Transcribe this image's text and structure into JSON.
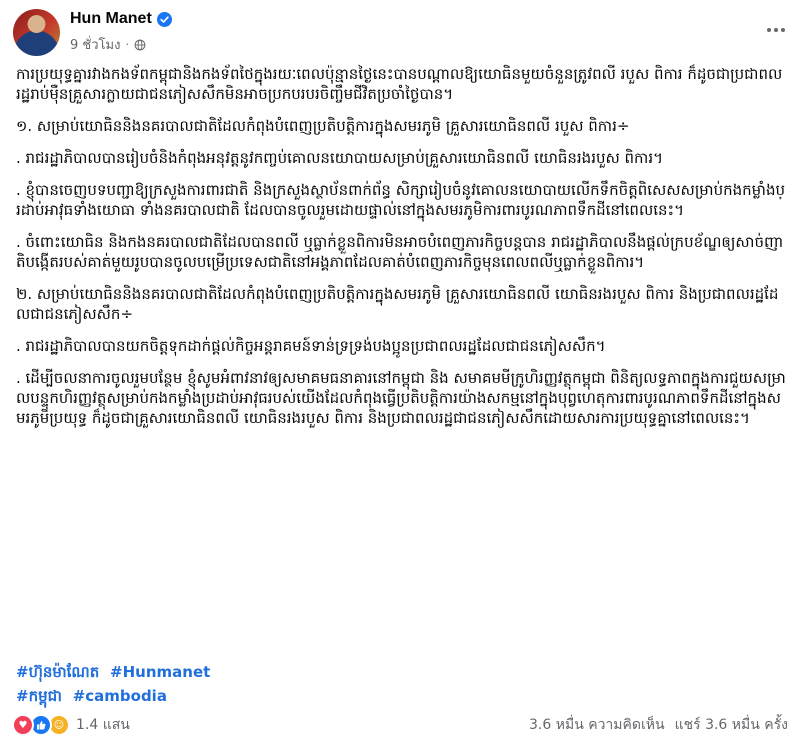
{
  "post": {
    "author": "Hun Manet",
    "time": "9 ชั่วโมง",
    "privacy_icon": "globe-icon",
    "verified_icon": "verified-badge-icon",
    "more_icon": "more-options-icon"
  },
  "content": {
    "paragraphs": [
      "ការប្រយុទ្ធគ្នារវាងកងទ័ពកម្ពុជានិងកងទ័ពថៃក្នុងរយៈពេលប៉ុន្មានថ្ងៃនេះបានបណ្តាលឱ្យយោធិនមួយចំនួនត្រូវពលី របួស ពិការ ក៏ដូចជាប្រជាពលរដ្ឋរាប់ម៉ឺនគ្រួសារក្លាយជាជនភៀសសឹកមិនអាចប្រកបរបរចិញ្ចឹមជីវិតប្រចាំថ្ងៃបាន។",
      "១. សម្រាប់យោធិននិងនគរបាលជាតិដែលកំពុងបំពេញប្រតិបត្តិការក្នុងសមរភូមិ គ្រួសារយោធិនពលី របួស ពិការ÷",
      ". រាជរដ្ឋាភិបាលបានរៀបចំនិងកំពុងអនុវត្តនូវកញ្ចប់គោលនយោបាយសម្រាប់គ្រួសារយោធិនពលី យោធិនរងរបួស ពិការ។",
      ". ខ្ញុំបានចេញបទបញ្ជាឱ្យក្រសួងការពារជាតិ និងក្រសួងស្ថាប័នពាក់ព័ន្ធ សិក្សារៀបចំនូវគោលនយោបាយលើកទឹកចិត្តពិសេសសម្រាប់កងកម្លាំងប្រដាប់អាវុធទាំងយោធា ទាំងនគរបាលជាតិ ដែលបានចូលរួមដោយផ្ទាល់នៅក្នុងសមរភូមិការពារបូរណភាពទឹកដីនៅពេលនេះ។",
      ". ចំពោះយោធិន និងកងនគរបាលជាតិដែលបានពលី ឬធ្លាក់ខ្លួនពិការមិនអាចបំពេញភារកិច្ចបន្តបាន រាជរដ្ឋាភិបាលនឹងផ្តល់ក្របខ័ណ្ឌឲ្យសាច់ញាតិបង្កើតរបស់គាត់មួយរូបបានចូលបម្រើប្រទេសជាតិនៅអង្គភាពដែលគាត់បំពេញភារកិច្ចមុនពេលពលីឬធ្លាក់ខ្លួនពិការ។",
      "២. សម្រាប់យោធិននិងនគរបាលជាតិដែលកំពុងបំពេញប្រតិបត្តិការក្នុងសមរភូមិ គ្រួសារយោធិនពលី យោធិនរងរបួស ពិការ និងប្រជាពលរដ្ឋដែលជាជនភៀសសឹក÷",
      ". រាជរដ្ឋាភិបាលបានយកចិត្តទុកដាក់ផ្តល់កិច្ចអន្តរាគមន៍ទាន់ទ្រទ្រង់បងប្អូនប្រជាពលរដ្ឋដែលជាជនភៀសសឹក។",
      ". ដើម្បីចលនាការចូលរួមបន្ថែម ខ្ញុំសូមអំពាវនាវឲ្យសមាគមធនាគារនៅកម្ពុជា និង សមាគមមីក្រូហិរញ្ញវត្ថុកម្ពុជា ពិនិត្យលទ្ធភាពក្នុងការជួយសម្រាលបន្ទុកហិរញ្ញវត្ថុសម្រាប់កងកម្លាំងប្រដាប់អាវុធរបស់យើងដែលកំពុងធ្វើប្រតិបត្តិការយ៉ាងសកម្មនៅក្នុងបុព្វហេតុការពារបូរណភាពទឹកដីនៅក្នុងសមរភូមិប្រយុទ្ធ ក៏ដូចជាគ្រួសារយោធិនពលី យោធិនរងរបួស ពិការ និងប្រជាពលរដ្ឋជាជនភៀសសឹកដោយសារការប្រយុទ្ធគ្នានៅពេលនេះ។"
    ]
  },
  "hashtags": {
    "line1": [
      "#ហ៊ុនម៉ាណែត",
      "#Hunmanet"
    ],
    "line2": [
      "#កម្ពុជា",
      "#cambodia"
    ]
  },
  "footer": {
    "reaction_count": "1.4 แสน",
    "comments": "3.6 หมื่น ความคิดเห็น",
    "shares": "แชร์ 3.6 หมื่น ครั้ง",
    "reaction_icons": [
      "love-icon",
      "like-icon",
      "care-icon"
    ]
  },
  "colors": {
    "link": "#216fdb",
    "secondary_text": "#65676b",
    "verified": "#1877f2"
  }
}
